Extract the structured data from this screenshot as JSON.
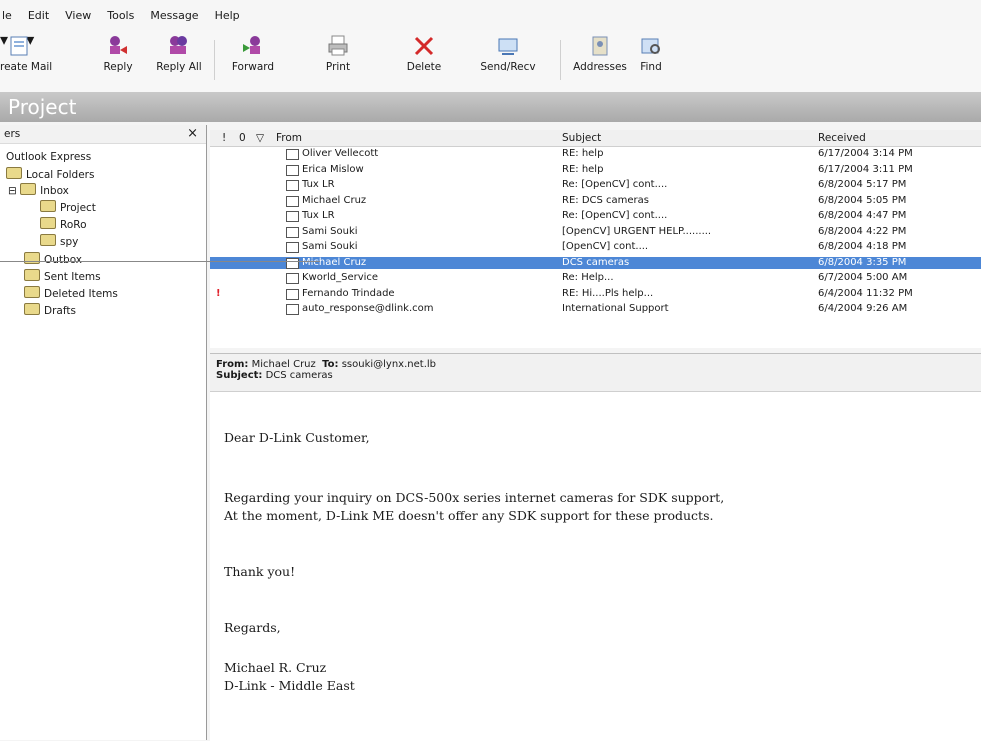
{
  "menu": [
    "le",
    "Edit",
    "View",
    "Tools",
    "Message",
    "Help"
  ],
  "toolbar": {
    "create_mail": "reate Mail",
    "reply": "Reply",
    "reply_all": "Reply All",
    "forward": "Forward",
    "print": "Print",
    "delete": "Delete",
    "send_recv": "Send/Recv",
    "addresses": "Addresses",
    "find": "Find"
  },
  "title": "Project",
  "folders": {
    "header": "ers",
    "close": "×",
    "items": [
      "Outlook Express",
      "Local Folders",
      "Inbox",
      "Project",
      "RoRo",
      "spy",
      "Outbox",
      "Sent Items",
      "Deleted Items",
      "Drafts"
    ],
    "expander": "⊟"
  },
  "columns": {
    "priority": "!",
    "attach": "0",
    "flag": "▽",
    "from": "From",
    "subject": "Subject",
    "received": "Received"
  },
  "messages": [
    {
      "flag": "",
      "from": "Oliver Vellecott",
      "subject": "RE: help",
      "received": "6/17/2004 3:14 PM"
    },
    {
      "flag": "",
      "from": "Erica Mislow",
      "subject": "RE: help",
      "received": "6/17/2004 3:11 PM"
    },
    {
      "flag": "",
      "from": "Tux LR",
      "subject": "Re: [OpenCV] cont....",
      "received": "6/8/2004 5:17 PM"
    },
    {
      "flag": "",
      "from": "Michael Cruz",
      "subject": "RE: DCS cameras",
      "received": "6/8/2004 5:05 PM"
    },
    {
      "flag": "",
      "from": "Tux LR",
      "subject": "Re: [OpenCV] cont....",
      "received": "6/8/2004 4:47 PM"
    },
    {
      "flag": "",
      "from": "Sami Souki",
      "subject": "[OpenCV] URGENT HELP.........",
      "received": "6/8/2004 4:22 PM"
    },
    {
      "flag": "",
      "from": "Sami Souki",
      "subject": "[OpenCV] cont....",
      "received": "6/8/2004 4:18 PM"
    },
    {
      "flag": "",
      "from": "Michael Cruz",
      "subject": "DCS cameras",
      "received": "6/8/2004 3:35 PM"
    },
    {
      "flag": "",
      "from": "Kworld_Service",
      "subject": "Re: Help...",
      "received": "6/7/2004 5:00 AM"
    },
    {
      "flag": "!",
      "from": "Fernando Trindade",
      "subject": "RE: Hi....Pls help...",
      "received": "6/4/2004 11:32 PM"
    },
    {
      "flag": "",
      "from": "auto_response@dlink.com",
      "subject": "International Support",
      "received": "6/4/2004 9:26 AM"
    }
  ],
  "preview": {
    "from_label": "From:",
    "from": "Michael Cruz",
    "to_label": "To:",
    "to": "ssouki@lynx.net.lb",
    "subject_label": "Subject:",
    "subject": "DCS cameras",
    "body": [
      "Dear D-Link Customer,",
      "Regarding your inquiry on DCS-500x series internet cameras for SDK support,",
      "At the moment, D-Link ME doesn't offer any SDK support for these products.",
      "Thank you!",
      "Regards,",
      "Michael R. Cruz",
      "D-Link - Middle East"
    ]
  }
}
